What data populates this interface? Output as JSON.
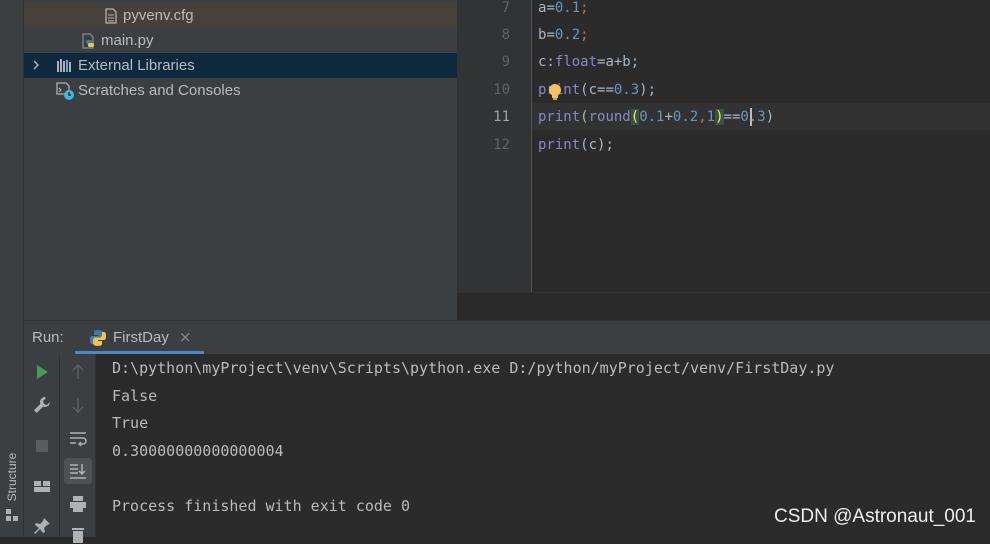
{
  "project_tree": {
    "items": [
      {
        "label": "pyvenv.cfg"
      },
      {
        "label": "main.py"
      },
      {
        "label": "External Libraries"
      },
      {
        "label": "Scratches and Consoles"
      }
    ]
  },
  "left_strip": {
    "structure_label": "Structure"
  },
  "editor": {
    "lines": [
      {
        "num": "7",
        "code": {
          "a": "a",
          "b": "=",
          "c": "0.1",
          "d": ";"
        }
      },
      {
        "num": "8",
        "code": {
          "a": "b",
          "b": "=",
          "c": "0.2",
          "d": ";"
        }
      },
      {
        "num": "9",
        "code": {
          "a": "c:",
          "b": "float",
          "c": "=a+b;"
        }
      },
      {
        "num": "10",
        "code": {
          "a": "print",
          "b": "(c==",
          "c": "0.3",
          "d": ");"
        }
      },
      {
        "num": "11",
        "code": {
          "a": "print",
          "b": "(",
          "c": "round",
          "d": "(",
          "e": "0.1",
          "f": "+",
          "g": "0.2",
          "h": ",",
          "i": "1",
          "j": ")",
          "k": "==",
          "l": "0.3",
          "m": ")"
        }
      },
      {
        "num": "12",
        "code": {
          "a": "print",
          "b": "(c);"
        }
      }
    ]
  },
  "run": {
    "title": "Run:",
    "tab_label": "FirstDay",
    "close_glyph": "×",
    "console_lines": [
      "D:\\python\\myProject\\venv\\Scripts\\python.exe D:/python/myProject/venv/FirstDay.py",
      "False",
      "True",
      "0.30000000000000004",
      "",
      "Process finished with exit code 0"
    ]
  },
  "watermark": "CSDN @Astronaut_001",
  "colors": {
    "accent": "#4a88c7",
    "keyword": "#cc7832",
    "number": "#6897bb",
    "builtin": "#8888c6",
    "text": "#a9b7c6"
  }
}
